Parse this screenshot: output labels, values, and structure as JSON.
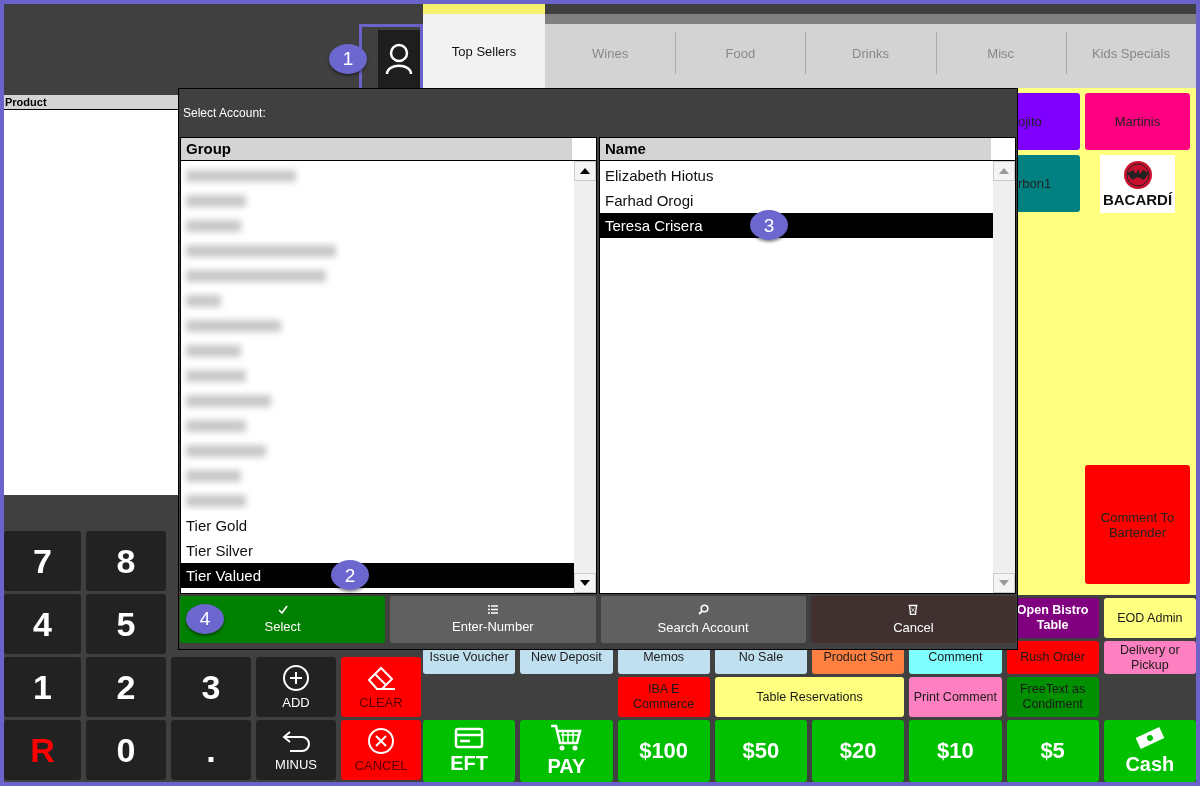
{
  "user_button": {
    "callout": "1"
  },
  "tabs": [
    {
      "label": "Top Sellers",
      "selected": true
    },
    {
      "label": "Wines",
      "selected": false
    },
    {
      "label": "Food",
      "selected": false
    },
    {
      "label": "Drinks",
      "selected": false
    },
    {
      "label": "Misc",
      "selected": false
    },
    {
      "label": "Kids Specials",
      "selected": false
    }
  ],
  "product_list": {
    "header": "Product"
  },
  "tiles": [
    {
      "kind": "partial",
      "label": "ojito",
      "color": "#8000ff"
    },
    {
      "kind": "full",
      "label": "Martinis",
      "color": "#ff0080"
    },
    {
      "kind": "partial",
      "label": "rbon1",
      "color": "#008080"
    },
    {
      "kind": "logo",
      "label": "BACARDÍ"
    },
    {
      "kind": "full",
      "label": "Comment To Bartender",
      "color": "#ff0000"
    }
  ],
  "keypad": [
    [
      {
        "kind": "digit",
        "label": "7"
      },
      {
        "kind": "digit",
        "label": "8"
      }
    ],
    [
      {
        "kind": "digit",
        "label": "4"
      },
      {
        "kind": "digit",
        "label": "5"
      }
    ],
    [
      {
        "kind": "digit",
        "label": "1"
      },
      {
        "kind": "digit",
        "label": "2"
      },
      {
        "kind": "digit",
        "label": "3"
      },
      {
        "kind": "add",
        "label": "ADD"
      },
      {
        "kind": "clear",
        "label": "CLEAR"
      }
    ],
    [
      {
        "kind": "reset",
        "label": "R"
      },
      {
        "kind": "digit",
        "label": "0"
      },
      {
        "kind": "digit",
        "label": "."
      },
      {
        "kind": "minus",
        "label": "MINUS"
      },
      {
        "kind": "cancel",
        "label": "CANCEL"
      }
    ]
  ],
  "function_rows": [
    [
      {
        "kind": "emphasis",
        "label": "Open Bistro Table",
        "color": "#800080"
      },
      {
        "kind": "plain",
        "label": "EOD Admin",
        "color": "#ffff80"
      }
    ],
    [
      {
        "kind": "plain",
        "label": "Issue Voucher",
        "color": "#c0e0f0"
      },
      {
        "kind": "plain",
        "label": "New Deposit",
        "color": "#c0e0f0"
      },
      {
        "kind": "plain",
        "label": "Memos",
        "color": "#c0e0f0"
      },
      {
        "kind": "plain",
        "label": "No Sale",
        "color": "#c0e0f0"
      },
      {
        "kind": "plain",
        "label": "Product Sort",
        "color": "#ff8040"
      },
      {
        "kind": "plain",
        "label": "Comment",
        "color": "#80ffff"
      },
      {
        "kind": "plain",
        "label": "Rush Order",
        "color": "#ff0000"
      },
      {
        "kind": "plain",
        "label": "Delivery or Pickup",
        "color": "#ff80c0"
      }
    ],
    [
      {
        "kind": "plain",
        "label": "IBA E Commerce",
        "color": "#ff0000"
      },
      {
        "kind": "wide",
        "label": "Table Reservations",
        "color": "#ffff80"
      },
      {
        "kind": "plain",
        "label": "Print Comment",
        "color": "#ff80c0"
      },
      {
        "kind": "plain",
        "label": "FreeText as Condiment",
        "color": "#009000"
      }
    ],
    [
      {
        "kind": "card",
        "label": "EFT",
        "color": "#00c000"
      },
      {
        "kind": "cart",
        "label": "PAY",
        "color": "#00c000"
      },
      {
        "kind": "amount",
        "label": "$100",
        "color": "#00c000"
      },
      {
        "kind": "amount",
        "label": "$50",
        "color": "#00c000"
      },
      {
        "kind": "amount",
        "label": "$20",
        "color": "#00c000"
      },
      {
        "kind": "amount",
        "label": "$10",
        "color": "#00c000"
      },
      {
        "kind": "amount",
        "label": "$5",
        "color": "#00c000"
      },
      {
        "kind": "cash",
        "label": "Cash",
        "color": "#00c000"
      }
    ]
  ],
  "dialog": {
    "title": "Select Account:",
    "group_list": {
      "header": "Group",
      "items": [
        {
          "kind": "redacted",
          "selected": false
        },
        {
          "kind": "redacted",
          "selected": false
        },
        {
          "kind": "redacted",
          "selected": false
        },
        {
          "kind": "redacted",
          "selected": false
        },
        {
          "kind": "redacted",
          "selected": false
        },
        {
          "kind": "redacted",
          "selected": false
        },
        {
          "kind": "redacted",
          "selected": false
        },
        {
          "kind": "redacted",
          "selected": false
        },
        {
          "kind": "redacted",
          "selected": false
        },
        {
          "kind": "redacted",
          "selected": false
        },
        {
          "kind": "redacted",
          "selected": false
        },
        {
          "kind": "redacted",
          "selected": false
        },
        {
          "kind": "redacted",
          "selected": false
        },
        {
          "kind": "redacted",
          "selected": false
        },
        {
          "kind": "text",
          "label": "Tier Gold",
          "selected": false
        },
        {
          "kind": "text",
          "label": "Tier Silver",
          "selected": false
        },
        {
          "kind": "text",
          "label": "Tier Valued",
          "selected": true,
          "callout": "2"
        }
      ]
    },
    "name_list": {
      "header": "Name",
      "items": [
        {
          "kind": "text",
          "label": "Elizabeth Hiotus",
          "selected": false
        },
        {
          "kind": "text",
          "label": "Farhad Orogi",
          "selected": false
        },
        {
          "kind": "text",
          "label": "Teresa Crisera",
          "selected": true,
          "callout": "3"
        }
      ]
    },
    "buttons": [
      {
        "kind": "select",
        "label": "Select",
        "callout": "4"
      },
      {
        "kind": "enter-number",
        "label": "Enter-Number"
      },
      {
        "kind": "search",
        "label": "Search Account"
      },
      {
        "kind": "cancel",
        "label": "Cancel"
      }
    ]
  }
}
